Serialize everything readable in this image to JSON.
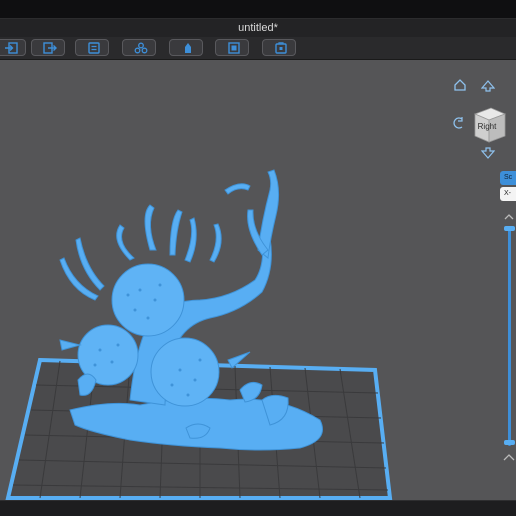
{
  "window": {
    "title": "untitled*"
  },
  "toolbar": {
    "buttons": [
      {
        "icon": "import-icon"
      },
      {
        "icon": "export-icon"
      },
      {
        "icon": "document-icon"
      },
      {
        "icon": "repair-icon"
      },
      {
        "icon": "support-icon"
      },
      {
        "icon": "layout-icon"
      },
      {
        "icon": "save-icon"
      }
    ]
  },
  "view_cube": {
    "face_label": "Right"
  },
  "side_panel": {
    "tab_top": "Sc",
    "tab_bottom": "X-"
  },
  "layer_slider": {
    "upper_fraction": 1.0,
    "lower_fraction": 0.0
  },
  "colors": {
    "accent": "#3d8fd9",
    "model": "#58aef3",
    "viewport": "#555557"
  }
}
